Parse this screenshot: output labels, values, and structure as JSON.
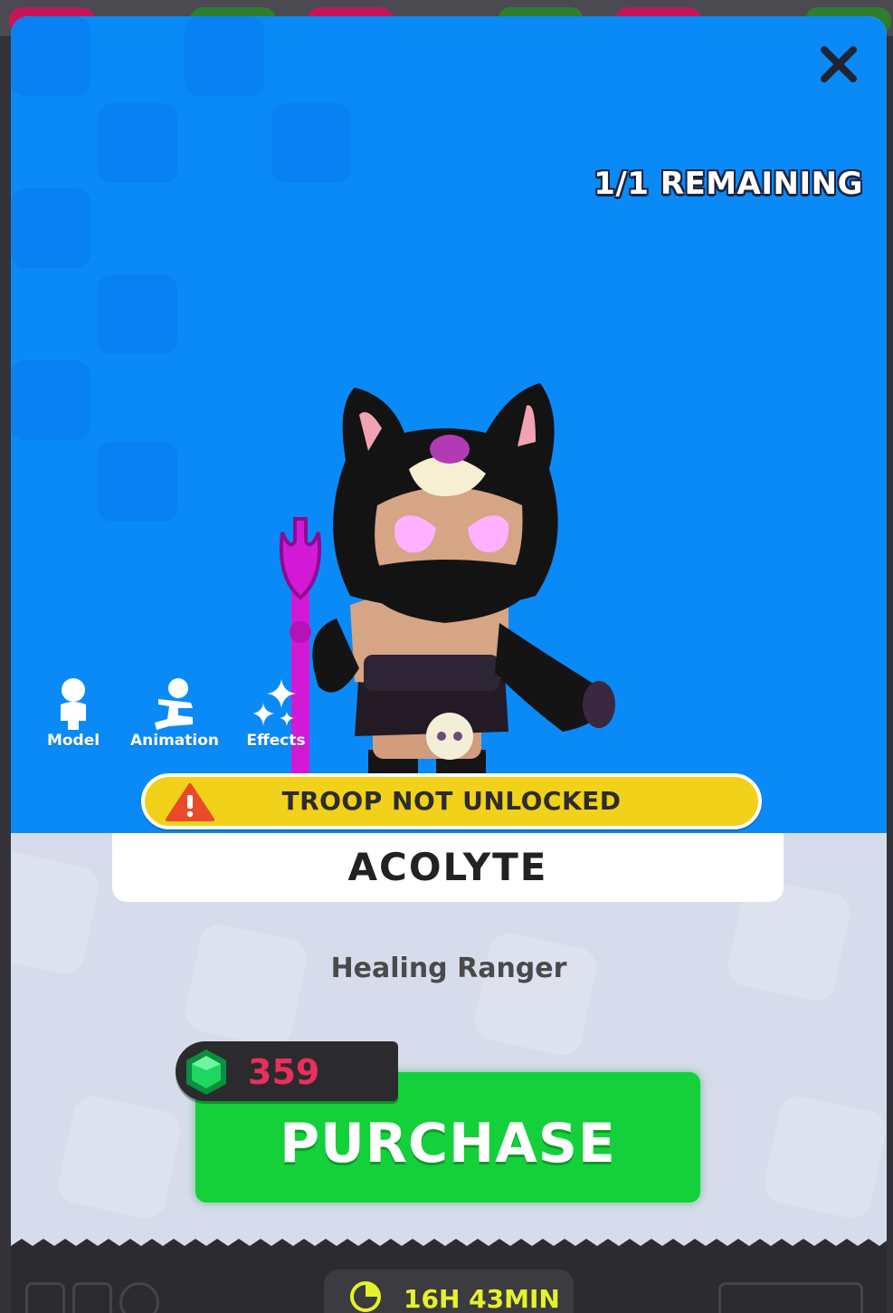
{
  "header": {
    "remaining": "1/1 REMAINING"
  },
  "view_tabs": [
    {
      "label": "Model",
      "icon": "person-icon"
    },
    {
      "label": "Animation",
      "icon": "pose-icon"
    },
    {
      "label": "Effects",
      "icon": "sparkle-icon"
    }
  ],
  "warning": {
    "text": "TROOP NOT UNLOCKED",
    "icon": "warning-triangle-icon"
  },
  "troop": {
    "name": "ACOLYTE",
    "role": "Healing Ranger"
  },
  "purchase": {
    "label": "PURCHASE",
    "price": "359",
    "currency_icon": "green-gem-icon"
  },
  "timer": {
    "text": "16H 43MIN",
    "icon": "clock-icon"
  },
  "colors": {
    "hero_bg": "#0a8af7",
    "warning": "#f1d11a",
    "purchase": "#14d03a",
    "price": "#ea2f5d",
    "timer_text": "#e6f22a"
  }
}
